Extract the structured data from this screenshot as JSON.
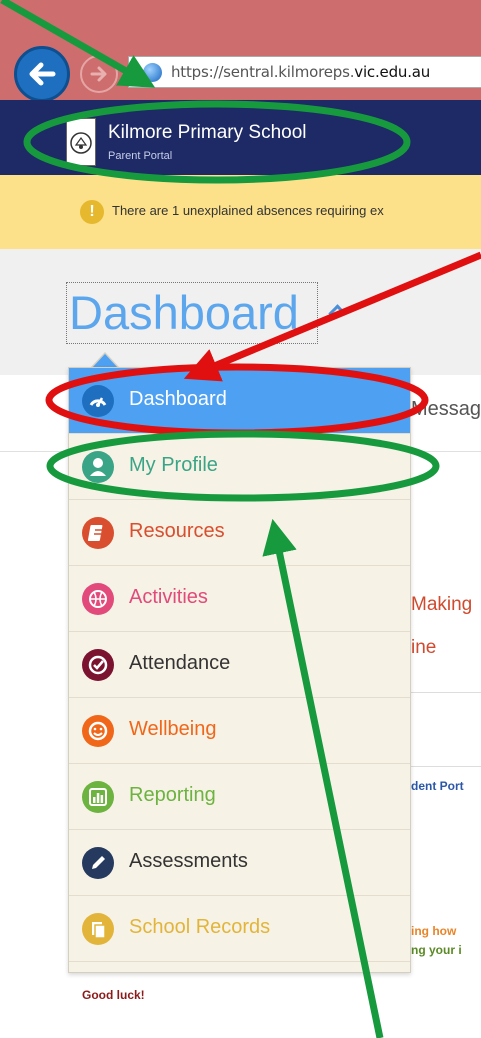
{
  "browser": {
    "url_prefix": "https://sentral.kilmoreps.",
    "url_domain": "vic.edu.au"
  },
  "school": {
    "name": "Kilmore Primary School",
    "subtitle": "Parent Portal"
  },
  "alert": {
    "text": "There are 1 unexplained absences requiring ex"
  },
  "page": {
    "title": "Dashboard"
  },
  "background": {
    "tab_text": "Messag",
    "item1": "Making",
    "item2": "ine",
    "link": "dent Port",
    "note1": "ing how",
    "note2": "ng your i",
    "footer": "Good luck!"
  },
  "menu": [
    {
      "label": "Dashboard",
      "icon": "dashboard-icon",
      "color": "#ffffff",
      "icon_bg": "#1f6fc1",
      "active": true
    },
    {
      "label": "My Profile",
      "icon": "user-icon",
      "color": "#3aa586",
      "icon_bg": "#3aa586"
    },
    {
      "label": "Resources",
      "icon": "book-icon",
      "color": "#d94e2e",
      "icon_bg": "#d94e2e"
    },
    {
      "label": "Activities",
      "icon": "basketball-icon",
      "color": "#e14a7a",
      "icon_bg": "#e14a7a"
    },
    {
      "label": "Attendance",
      "icon": "check-circle-icon",
      "color": "#333333",
      "icon_bg": "#7b1330"
    },
    {
      "label": "Wellbeing",
      "icon": "smile-icon",
      "color": "#f0671a",
      "icon_bg": "#f0671a"
    },
    {
      "label": "Reporting",
      "icon": "bar-chart-icon",
      "color": "#6cb33f",
      "icon_bg": "#6cb33f"
    },
    {
      "label": "Assessments",
      "icon": "pencil-icon",
      "color": "#333333",
      "icon_bg": "#253a5e"
    },
    {
      "label": "School Records",
      "icon": "records-icon",
      "color": "#e2b53a",
      "icon_bg": "#e2b53a"
    }
  ]
}
